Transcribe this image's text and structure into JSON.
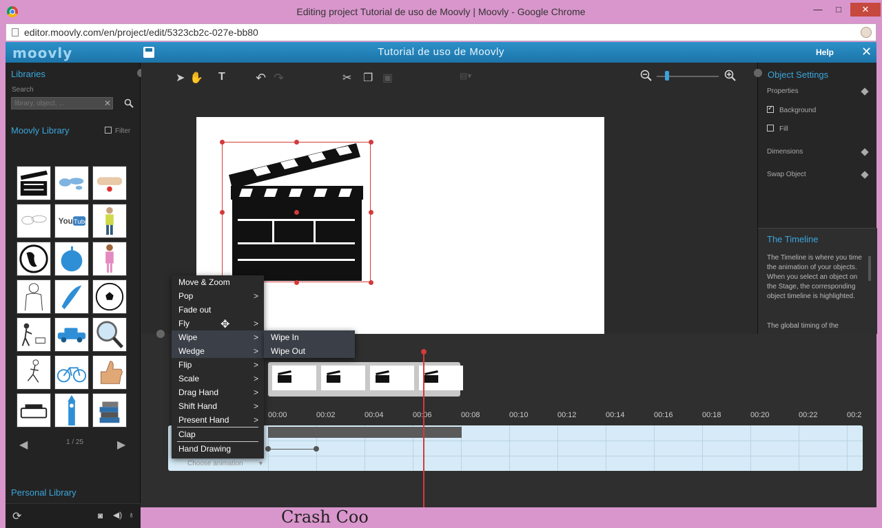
{
  "window": {
    "title": "Editing project Tutorial de uso de Moovly | Moovly - Google Chrome",
    "url": "editor.moovly.com/en/project/edit/5323cb2c-027e-bb80",
    "minimize": "—",
    "maximize": "□",
    "close": "✕"
  },
  "app": {
    "logo": "moovly",
    "title": "Tutorial de uso de Moovly",
    "help": "Help",
    "close": "✕"
  },
  "libraries": {
    "title": "Libraries",
    "search_label": "Search",
    "search_placeholder": "library, object, ...",
    "moovly_library": "Moovly Library",
    "filter": "Filter",
    "pager": "1 / 25",
    "personal_library": "Personal Library",
    "thumbs": [
      "clapperboard",
      "world-map",
      "scroll",
      "world-outline",
      "youtube",
      "man",
      "globe",
      "apple",
      "woman",
      "businessman",
      "banana",
      "soccer-ball",
      "runner-cart",
      "car",
      "magnifier",
      "runner",
      "bicycle",
      "thumbs-up",
      "typewriter",
      "big-ben",
      "books"
    ]
  },
  "object_settings": {
    "title": "Object Settings",
    "properties": "Properties",
    "background": "Background",
    "background_checked": true,
    "fill": "Fill",
    "fill_checked": false,
    "dimensions": "Dimensions",
    "swap_object": "Swap Object"
  },
  "timeline_help": {
    "title": "The Timeline",
    "text": "The Timeline is where you time the animation of your objects. When you select an object on the Stage, the corresponding object timeline is highlighted.",
    "text2": "The global timing of the"
  },
  "timeline": {
    "ticks": [
      "00:00",
      "00:02",
      "00:04",
      "00:06",
      "00:08",
      "00:10",
      "00:12",
      "00:14",
      "00:16",
      "00:18",
      "00:20",
      "00:22",
      "00:2"
    ],
    "choose_animation": "Choose animation",
    "playhead_time": "00:06"
  },
  "animation_menu": {
    "items": [
      {
        "label": "Move & Zoom",
        "has_sub": false
      },
      {
        "label": "Pop",
        "has_sub": true
      },
      {
        "label": "Fade out",
        "has_sub": false
      },
      {
        "label": "Fly",
        "has_sub": true
      },
      {
        "label": "Wipe",
        "has_sub": true
      },
      {
        "label": "Wedge",
        "has_sub": true
      },
      {
        "label": "Flip",
        "has_sub": true
      },
      {
        "label": "Scale",
        "has_sub": true
      },
      {
        "label": "Drag Hand",
        "has_sub": true
      },
      {
        "label": "Shift Hand",
        "has_sub": true
      },
      {
        "label": "Present Hand",
        "has_sub": true
      },
      {
        "label": "Clap",
        "has_sub": false
      },
      {
        "label": "Hand Drawing",
        "has_sub": false
      }
    ],
    "submenu": [
      "Wipe In",
      "Wipe Out"
    ]
  },
  "colors": {
    "accent": "#3aa6dc",
    "playhead": "#d43a3a",
    "topbar": "#1d74a8"
  },
  "footer_text": "Crash Coo"
}
